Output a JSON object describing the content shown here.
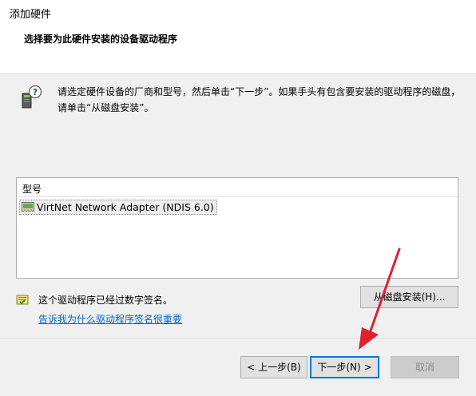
{
  "window": {
    "title": "添加硬件",
    "subheading": "选择要为此硬件安装的设备驱动程序"
  },
  "instructions": {
    "line1": "请选定硬件设备的厂商和型号，然后单击“下一步”。如果手头有包含要安装的驱动程序的磁盘，",
    "line2": "请单击“从磁盘安装”。"
  },
  "model_list": {
    "header": "型号",
    "items": [
      {
        "label": "VirtNet Network Adapter (NDIS 6.0)",
        "icon": "network-adapter-icon",
        "selected": true
      }
    ]
  },
  "signature": {
    "text": "这个驱动程序已经过数字签名。",
    "link": "告诉我为什么驱动程序签名很重要",
    "icon": "signed-driver-icon"
  },
  "buttons": {
    "have_disk": "从磁盘安装(H)...",
    "back": "< 上一步(B)",
    "next": "下一步(N) >",
    "cancel": "取消"
  },
  "colors": {
    "accent": "#0078d7",
    "link": "#0066cc",
    "annotation_arrow": "#e0202c"
  }
}
